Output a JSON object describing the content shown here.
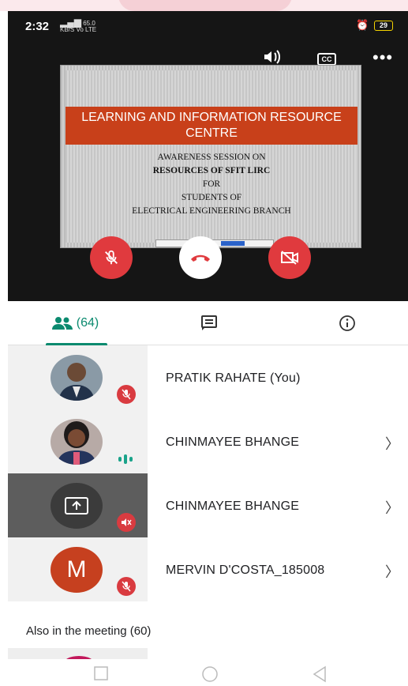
{
  "status": {
    "time": "2:32",
    "network": "4G",
    "speed": "65.0",
    "speed_unit": "KB/S",
    "lte": "Vo LTE",
    "battery": "29"
  },
  "slide": {
    "banner": "LEARNING AND INFORMATION RESOURCE CENTRE",
    "line1": "AWARENESS SESSION ON",
    "line2": "RESOURCES OF SFIT LIRC",
    "line3": "FOR",
    "line4": "STUDENTS OF",
    "line5": "ELECTRICAL ENGINEERING BRANCH"
  },
  "tabs": {
    "people_count": "(64)"
  },
  "participants": [
    {
      "name": "PRATIK RAHATE (You)"
    },
    {
      "name": "CHINMAYEE BHANGE"
    },
    {
      "name": "CHINMAYEE BHANGE"
    },
    {
      "name": "MERVIN D'COSTA_185008",
      "initial": "M"
    }
  ],
  "also_in_meeting": "Also in the meeting (60)",
  "colors": {
    "accent": "#0b8a6f",
    "danger": "#e03a3e",
    "banner": "#c8401a"
  },
  "icons": {
    "people": "people-icon",
    "chat": "chat-icon",
    "info": "info-icon",
    "volume": "volume-icon",
    "captions": "captions-icon",
    "more": "more-icon"
  }
}
